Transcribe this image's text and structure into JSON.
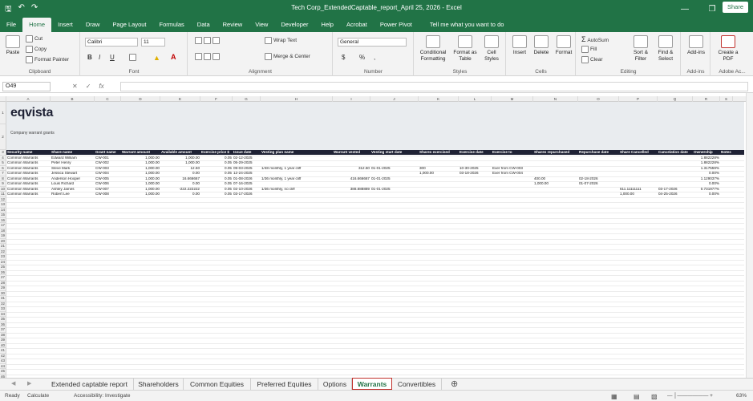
{
  "window": {
    "title": "Tech Corp_ExtendedCaptable_report_April 25, 2026  -  Excel"
  },
  "menu": {
    "items": [
      "File",
      "Home",
      "Insert",
      "Draw",
      "Page Layout",
      "Formulas",
      "Data",
      "Review",
      "View",
      "Developer",
      "Help",
      "Acrobat",
      "Power Pivot"
    ],
    "tell_me": "Tell me what you want to do",
    "share": "Share"
  },
  "ribbon": {
    "clipboard": {
      "paste": "Paste",
      "cut": "Cut",
      "copy": "Copy",
      "format_painter": "Format Painter",
      "label": "Clipboard"
    },
    "font": {
      "name": "Calibri",
      "size": "11",
      "label": "Font",
      "bold": "B",
      "italic": "I",
      "underline": "U"
    },
    "alignment": {
      "wrap": "Wrap Text",
      "merge": "Merge & Center",
      "label": "Alignment"
    },
    "number": {
      "format": "General",
      "label": "Number",
      "currency": "$",
      "percent": "%",
      "comma": ","
    },
    "styles": {
      "conditional": "Conditional Formatting",
      "table": "Format as Table",
      "cell": "Cell Styles",
      "label": "Styles"
    },
    "cells": {
      "insert": "Insert",
      "delete": "Delete",
      "format": "Format",
      "label": "Cells"
    },
    "editing": {
      "autosum": "AutoSum",
      "fill": "Fill",
      "clear": "Clear",
      "sort": "Sort & Filter",
      "find": "Find & Select",
      "label": "Editing"
    },
    "addins": {
      "addins": "Add-ins",
      "label": "Add-ins"
    },
    "adobe": {
      "create": "Create a PDF",
      "label": "Adobe Ac..."
    }
  },
  "formula_bar": {
    "name_box": "O49",
    "formula": ""
  },
  "sheet": {
    "columns": [
      "A",
      "B",
      "C",
      "D",
      "E",
      "F",
      "G",
      "H",
      "I",
      "J",
      "K",
      "L",
      "M",
      "N",
      "O",
      "P",
      "Q",
      "R",
      "S"
    ],
    "logo": "eqvista",
    "subtitle": "Company warrant grants",
    "headers": [
      "Security name",
      "Share name",
      "Grant name",
      "Warrant amount",
      "Available amount",
      "Exercise price $",
      "Issue date",
      "Vesting plan name",
      "Warrant vested",
      "Vesting start date",
      "Shares exercised",
      "Exercise date",
      "Exercise to",
      "Shares repurchased",
      "Repurchase date",
      "Share Cancelled",
      "Cancelation date",
      "Ownership",
      "Notes"
    ],
    "rows": [
      [
        "Common Warrants",
        "Edward William",
        "CW-001",
        "1,000.00",
        "1,000.00",
        "0.05",
        "02-12-2025",
        "",
        "",
        "",
        "",
        "",
        "",
        "",
        "",
        "",
        "",
        "1.882228%",
        ""
      ],
      [
        "Common Warrants",
        "Peter Henry",
        "CW-002",
        "1,000.00",
        "1,000.00",
        "0.05",
        "05-29-2025",
        "",
        "",
        "",
        "",
        "",
        "",
        "",
        "",
        "",
        "",
        "1.882228%",
        ""
      ],
      [
        "Common Warrants",
        "Steve Mark",
        "CW-003",
        "1,000.00",
        "12.50",
        "0.05",
        "09-03-2025",
        "1/48 monthly, 1 year cliff",
        "312.50",
        "01-01-2025",
        "300",
        "10-30-2025",
        "Exer from CW-003",
        "",
        "",
        "",
        "",
        "1.317559%",
        ""
      ],
      [
        "Common Warrants",
        "Jessica Stewart",
        "CW-004",
        "1,000.00",
        "0.00",
        "0.05",
        "12-24-2025",
        "",
        "",
        "",
        "1,000.00",
        "03-18-2026",
        "Exer from CW-004",
        "",
        "",
        "",
        "",
        "0.00%",
        ""
      ],
      [
        "Common Warrants",
        "Anderson Hooper",
        "CW-005",
        "1,000.00",
        "16.666667",
        "0.05",
        "01-08-2026",
        "1/36 monthly, 1 year cliff",
        "416.666667",
        "01-01-2025",
        "",
        "",
        "",
        "400.00",
        "02-18-2026",
        "",
        "",
        "1.129037%",
        ""
      ],
      [
        "Common Warrants",
        "Louis Richard",
        "CW-006",
        "1,000.00",
        "0.00",
        "0.05",
        "07-16-2025",
        "",
        "",
        "",
        "",
        "",
        "",
        "1,000.00",
        "01-07-2026",
        "",
        "",
        "0.00%",
        ""
      ],
      [
        "Common Warrants",
        "Ashley James",
        "CW-007",
        "1,000.00",
        "-222.222222",
        "0.05",
        "02-10-2026",
        "1/36 monthly, no cliff",
        "388.888889",
        "01-01-2025",
        "",
        "",
        "",
        "",
        "",
        "611.11111111",
        "03-17-2026",
        "0.731977%",
        ""
      ],
      [
        "Common Warrants",
        "Robert Lee",
        "CW-008",
        "1,000.00",
        "0.00",
        "0.05",
        "03-17-2026",
        "",
        "",
        "",
        "",
        "",
        "",
        "",
        "",
        "1,000.00",
        "04-25-2026",
        "0.00%",
        ""
      ]
    ]
  },
  "tabs": [
    "Extended captable report",
    "Shareholders",
    "Common Equities",
    "Preferred Equities",
    "Options",
    "Warrants",
    "Convertibles"
  ],
  "active_tab": "Warrants",
  "status": {
    "ready": "Ready",
    "calculate": "Calculate",
    "accessibility": "Accessibility: Investigate",
    "zoom": "63%"
  }
}
